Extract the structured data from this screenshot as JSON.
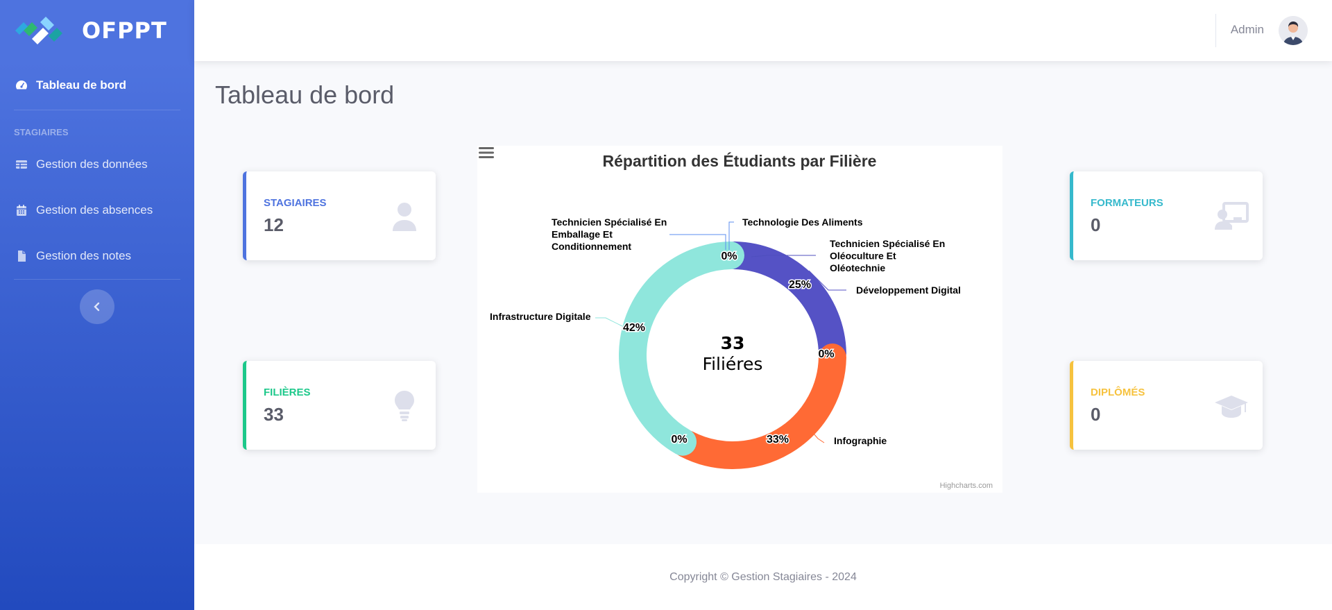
{
  "brand": {
    "name": "OFPPT"
  },
  "sidebar": {
    "dashboard_label": "Tableau de bord",
    "section_heading": "STAGIAIRES",
    "items": [
      {
        "label": "Gestion des données",
        "icon": "table-icon"
      },
      {
        "label": "Gestion des absences",
        "icon": "calendar-icon"
      },
      {
        "label": "Gestion des notes",
        "icon": "file-icon"
      }
    ]
  },
  "topbar": {
    "user_name": "Admin"
  },
  "page": {
    "title": "Tableau de bord"
  },
  "cards": [
    {
      "label": "STAGIAIRES",
      "value": "12",
      "color": "#4e73df",
      "icon": "user-icon"
    },
    {
      "label": "FILIÈRES",
      "value": "33",
      "color": "#1cc88a",
      "icon": "lightbulb-icon"
    },
    {
      "label": "FORMATEURS",
      "value": "0",
      "color": "#36b9cc",
      "icon": "chalkboard-teacher-icon"
    },
    {
      "label": "DIPLÔMÉS",
      "value": "0",
      "color": "#f6c23e",
      "icon": "graduation-cap-icon"
    }
  ],
  "chart_data": {
    "type": "pie",
    "title": "Répartition des Étudiants par Filière",
    "center_value": "33",
    "center_label": "Filiéres",
    "credits": "Highcharts.com",
    "slices": [
      {
        "name": "Technologie Des Aliments",
        "label": "0%",
        "value": 0,
        "color": "#5b8def"
      },
      {
        "name": "Technicien Spécialisé En Oléoculture Et Oléotechnie",
        "label": "",
        "value": 0,
        "color": "#4f4fbe"
      },
      {
        "name": "Développement Digital",
        "label": "25%",
        "value": 25,
        "color": "#5552c5"
      },
      {
        "name": "",
        "label": "0%",
        "value": 0,
        "color": "#ff6a35"
      },
      {
        "name": "Infographie",
        "label": "33%",
        "value": 33,
        "color": "#ff6a35"
      },
      {
        "name": "",
        "label": "0%",
        "value": 0,
        "color": "#ff6a35"
      },
      {
        "name": "Infrastructure Digitale",
        "label": "42%",
        "value": 42,
        "color": "#8fe6dc"
      },
      {
        "name": "Technicien Spécialisé En Emballage Et Conditionnement",
        "label": "",
        "value": 0,
        "color": "#5b8def"
      }
    ]
  },
  "footer": {
    "text": "Copyright © Gestion Stagiaires - 2024"
  }
}
